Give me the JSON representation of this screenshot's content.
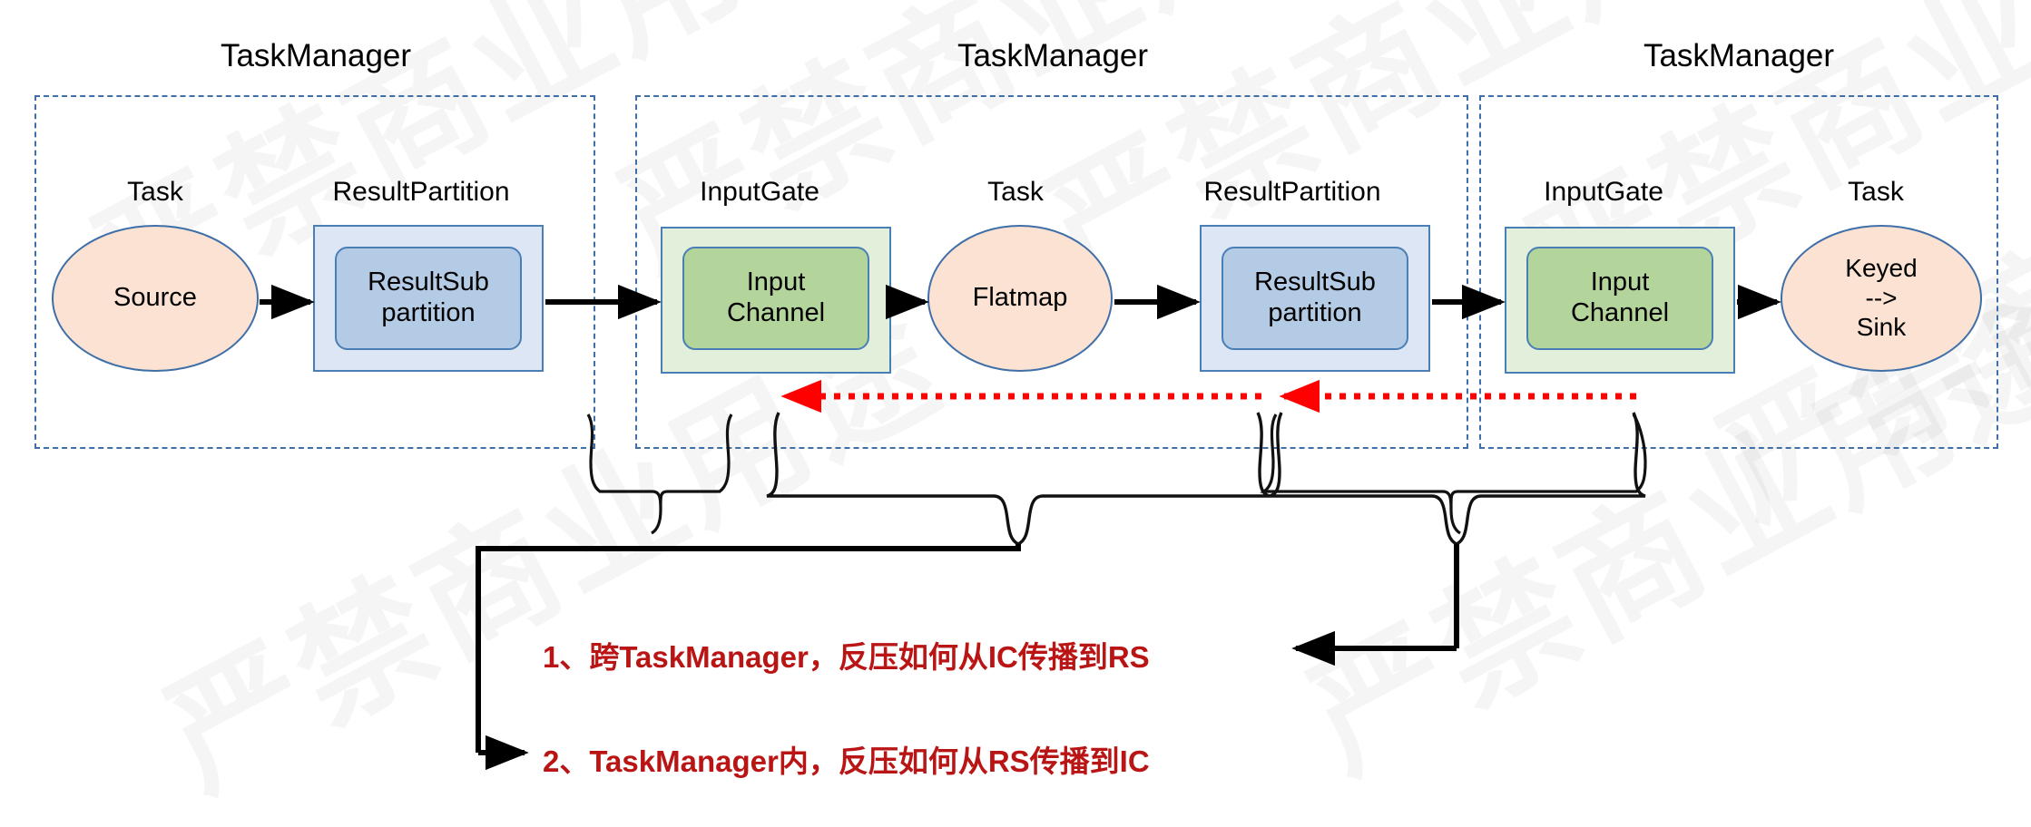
{
  "diagram": {
    "title_text": "TaskManager",
    "colors": {
      "dashed_border": "#3f6fa8",
      "outer_blue_fill": "#dce6f4",
      "outer_green_fill": "#e2efda",
      "inner_blue_fill": "#b4cbe6",
      "inner_green_fill": "#b3d49a",
      "ellipse_fill": "#fbe2d2",
      "shape_stroke": "#4a7fb5",
      "arrow_black": "#000000",
      "backpressure_red": "#ff0000",
      "note_red": "#b91515"
    },
    "taskmanagers": [
      {
        "name": "taskmanager-1",
        "title": "TaskManager",
        "captions": [
          "Task",
          "ResultPartition"
        ],
        "nodes": [
          {
            "kind": "ellipse",
            "label": "Source"
          },
          {
            "kind": "outer-inner-blue",
            "label": "ResultSub\npartition",
            "line1": "ResultSub",
            "line2": "partition"
          }
        ]
      },
      {
        "name": "taskmanager-2",
        "title": "TaskManager",
        "captions": [
          "InputGate",
          "Task",
          "ResultPartition"
        ],
        "nodes": [
          {
            "kind": "outer-inner-green",
            "line1": "Input",
            "line2": "Channel"
          },
          {
            "kind": "ellipse",
            "label": "Flatmap"
          },
          {
            "kind": "outer-inner-blue",
            "line1": "ResultSub",
            "line2": "partition"
          }
        ]
      },
      {
        "name": "taskmanager-3",
        "title": "TaskManager",
        "captions": [
          "InputGate",
          "Task"
        ],
        "nodes": [
          {
            "kind": "outer-inner-green",
            "line1": "Input",
            "line2": "Channel"
          },
          {
            "kind": "ellipse",
            "line1": "Keyed",
            "line2": "-->",
            "line3": "Sink"
          }
        ]
      }
    ],
    "labels": {
      "task": "Task",
      "result_partition": "ResultPartition",
      "input_gate": "InputGate",
      "source": "Source",
      "flatmap": "Flatmap",
      "result_sub_1": "ResultSub",
      "result_sub_2": "partition",
      "input_channel_1": "Input",
      "input_channel_2": "Channel",
      "keyed_1": "Keyed",
      "keyed_2": "-->",
      "keyed_3": "Sink"
    },
    "notes": [
      {
        "id": "note-1",
        "text": "1、跨TaskManager，反压如何从IC传播到RS"
      },
      {
        "id": "note-2",
        "text": "2、TaskManager内，反压如何从RS传播到IC"
      }
    ],
    "watermark_text": "严禁商业用途"
  }
}
